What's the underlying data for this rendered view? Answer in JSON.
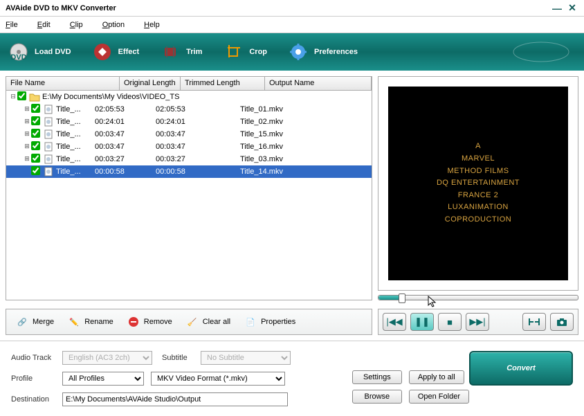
{
  "window": {
    "title": "AVAide DVD to MKV Converter"
  },
  "menu": {
    "file": "File",
    "edit": "Edit",
    "clip": "Clip",
    "option": "Option",
    "help": "Help"
  },
  "toolbar": {
    "load": "Load DVD",
    "effect": "Effect",
    "trim": "Trim",
    "crop": "Crop",
    "prefs": "Preferences"
  },
  "columns": {
    "file": "File Name",
    "orig": "Original Length",
    "trim": "Trimmed Length",
    "out": "Output Name"
  },
  "root_path": "E:\\My Documents\\My Videos\\VIDEO_TS",
  "rows": [
    {
      "name": "Title_...",
      "orig": "02:05:53",
      "trim": "02:05:53",
      "out": "Title_01.mkv"
    },
    {
      "name": "Title_...",
      "orig": "00:24:01",
      "trim": "00:24:01",
      "out": "Title_02.mkv"
    },
    {
      "name": "Title_...",
      "orig": "00:03:47",
      "trim": "00:03:47",
      "out": "Title_15.mkv"
    },
    {
      "name": "Title_...",
      "orig": "00:03:47",
      "trim": "00:03:47",
      "out": "Title_16.mkv"
    },
    {
      "name": "Title_...",
      "orig": "00:03:27",
      "trim": "00:03:27",
      "out": "Title_03.mkv"
    },
    {
      "name": "Title_...",
      "orig": "00:00:58",
      "trim": "00:00:58",
      "out": "Title_14.mkv"
    }
  ],
  "preview_text": {
    "l1": "A",
    "l2": "MARVEL",
    "l3": "METHOD FILMS",
    "l4": "DQ ENTERTAINMENT",
    "l5": "FRANCE 2",
    "l6": "LUXANIMATION",
    "l7": "COPRODUCTION"
  },
  "actions": {
    "merge": "Merge",
    "rename": "Rename",
    "remove": "Remove",
    "clear": "Clear all",
    "props": "Properties"
  },
  "form": {
    "audio_label": "Audio Track",
    "audio_value": "English (AC3 2ch)",
    "subtitle_label": "Subtitle",
    "subtitle_value": "No Subtitle",
    "profile_label": "Profile",
    "profile_cat": "All Profiles",
    "profile_fmt": "MKV Video Format (*.mkv)",
    "dest_label": "Destination",
    "dest_value": "E:\\My Documents\\AVAide Studio\\Output",
    "settings": "Settings",
    "apply_all": "Apply to all",
    "browse": "Browse",
    "open_folder": "Open Folder",
    "convert": "Convert"
  }
}
